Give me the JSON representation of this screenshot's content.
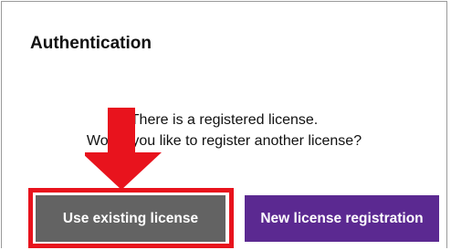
{
  "dialog": {
    "title": "Authentication",
    "message_line1": "There is a registered license.",
    "message_line2": "Would you like to register another license?"
  },
  "buttons": {
    "use_existing_label": "Use existing license",
    "new_registration_label": "New license registration"
  },
  "colors": {
    "use_existing_bg": "#636363",
    "new_registration_bg": "#5b2991",
    "annotation_red": "#e8131d"
  }
}
